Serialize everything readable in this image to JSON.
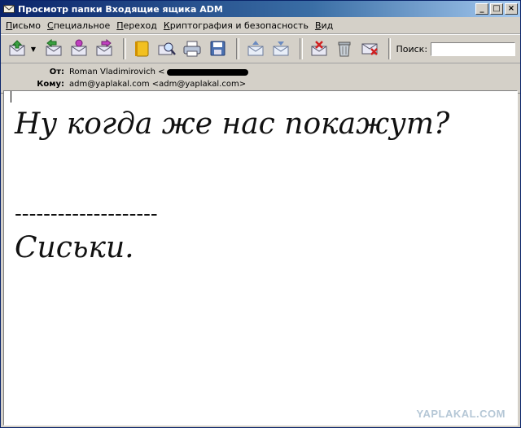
{
  "window": {
    "title": "Просмотр папки Входящие ящика ADM"
  },
  "menu": [
    "Письмо",
    "Специальное",
    "Переход",
    "Криптография и безопасность",
    "Вид"
  ],
  "toolbar": {
    "search_label": "Поиск:",
    "search_value": "",
    "icons": [
      "mail-get-icon",
      "mail-reply-icon",
      "mail-reply-all-icon",
      "mail-forward-icon",
      "mail-redirect-icon",
      "address-book-icon",
      "find-icon",
      "print-icon",
      "save-icon",
      "move-up-icon",
      "move-down-icon",
      "delete-mark-icon",
      "trash-icon",
      "junk-icon"
    ]
  },
  "headers": {
    "from_label": "От:",
    "from_value": "Roman Vladimirovich <",
    "to_label": "Кому:",
    "to_value": "adm@yaplakal.com <adm@yaplakal.com>"
  },
  "message": {
    "line1": "Ну когда же нас покажут?",
    "divider": "--------------------",
    "line2": "Сиськи."
  },
  "watermark": "YAPLAKAL.COM",
  "colors": {
    "titlebar": "#0a246a",
    "chrome": "#d4d0c8",
    "body_bg": "#ffffff"
  }
}
